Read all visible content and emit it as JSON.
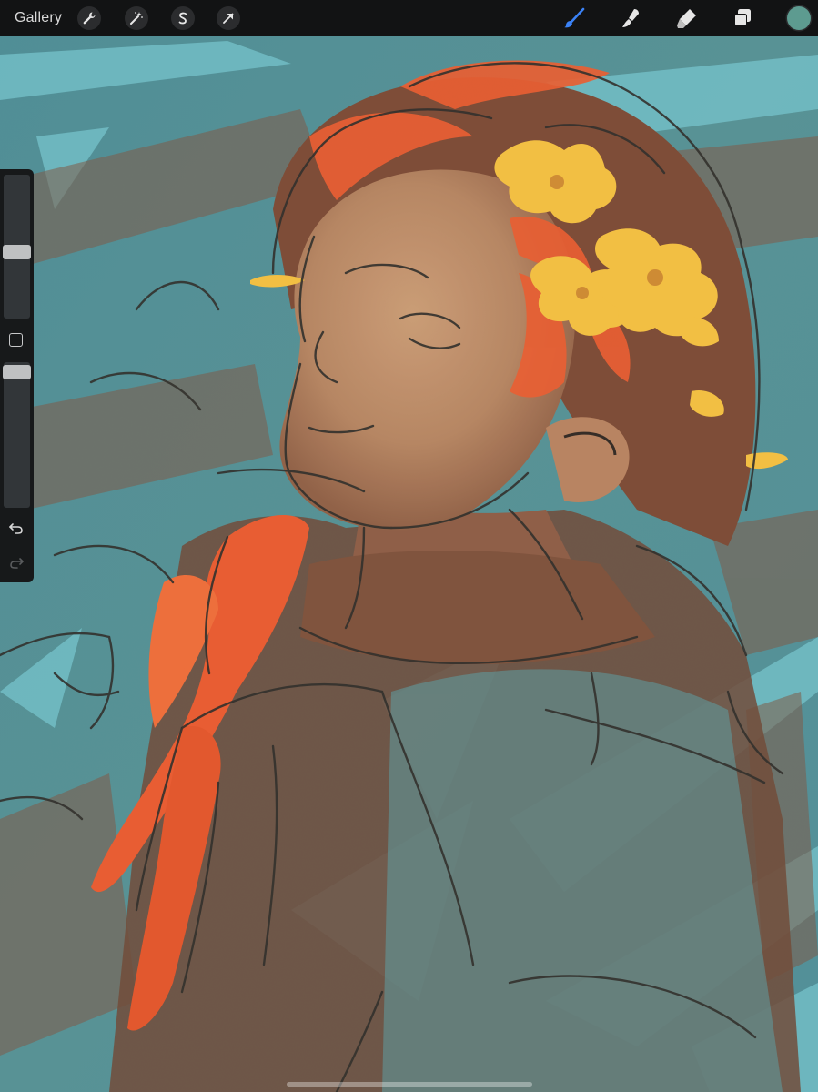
{
  "toolbar": {
    "gallery_label": "Gallery",
    "left_tools": [
      {
        "name": "actions",
        "icon": "wrench-icon"
      },
      {
        "name": "adjustments",
        "icon": "magic-wand-icon"
      },
      {
        "name": "selection",
        "icon": "selection-s-icon"
      },
      {
        "name": "transform",
        "icon": "arrow-cursor-icon"
      }
    ],
    "right_tools": [
      {
        "name": "brush",
        "icon": "brush-icon",
        "active": true
      },
      {
        "name": "smudge",
        "icon": "smudge-finger-icon",
        "active": false
      },
      {
        "name": "eraser",
        "icon": "eraser-icon",
        "active": false
      },
      {
        "name": "layers",
        "icon": "layers-icon",
        "active": false
      }
    ],
    "active_color": "#5d9b90",
    "active_tool_color": "#3b82f6"
  },
  "sidebar": {
    "brush_size": 0.46,
    "brush_opacity": 0.98,
    "undo_icon": "undo-icon",
    "redo_icon": "redo-icon",
    "modify_icon": "square-modify-icon"
  },
  "canvas": {
    "palette": {
      "background_teal": "#4f8a90",
      "light_teal": "#6fbcc4",
      "brown": "#7a4a34",
      "skin": "#b98865",
      "orange": "#e8582c",
      "flower_yellow": "#f2bc3c",
      "line": "#2f2620"
    }
  }
}
